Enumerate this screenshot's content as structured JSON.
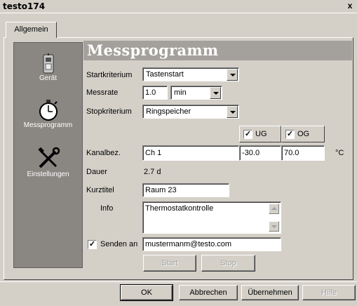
{
  "window": {
    "title": "testo174",
    "close_glyph": "x"
  },
  "tabs": [
    {
      "label": "Allgemein"
    }
  ],
  "nav": {
    "items": [
      {
        "label": "Gerät",
        "icon": "device-icon"
      },
      {
        "label": "Messprogramm",
        "icon": "stopwatch-icon"
      },
      {
        "label": "Einstellungen",
        "icon": "tools-icon"
      }
    ]
  },
  "header": {
    "title": "Messprogramm"
  },
  "form": {
    "startkriterium": {
      "label": "Startkriterium",
      "value": "Tastenstart"
    },
    "messrate": {
      "label": "Messrate",
      "value": "1.0",
      "unit": "min"
    },
    "stopkriterium": {
      "label": "Stopkriterium",
      "value": "Ringspeicher"
    },
    "ug": {
      "label": "UG",
      "checked": true
    },
    "og": {
      "label": "OG",
      "checked": true
    },
    "kanal": {
      "label": "Kanalbez.",
      "value": "Ch 1",
      "ug_value": "-30.0",
      "og_value": "70.0",
      "unit": "°C"
    },
    "dauer": {
      "label": "Dauer",
      "value": "2.7 d"
    },
    "kurztitel": {
      "label": "Kurztitel",
      "value": "Raum 23"
    },
    "info": {
      "label": "Info",
      "value": "Thermostatkontrolle"
    },
    "senden": {
      "label": "Senden an",
      "checked": true,
      "value": "mustermanm@testo.com"
    },
    "check_glyph": "✓",
    "start_label": "Start",
    "stop_label": "Stop"
  },
  "footer": {
    "ok": "OK",
    "abbrechen": "Abbrechen",
    "uebernehmen": "Übernehmen",
    "hilfe": "Hilfe"
  }
}
